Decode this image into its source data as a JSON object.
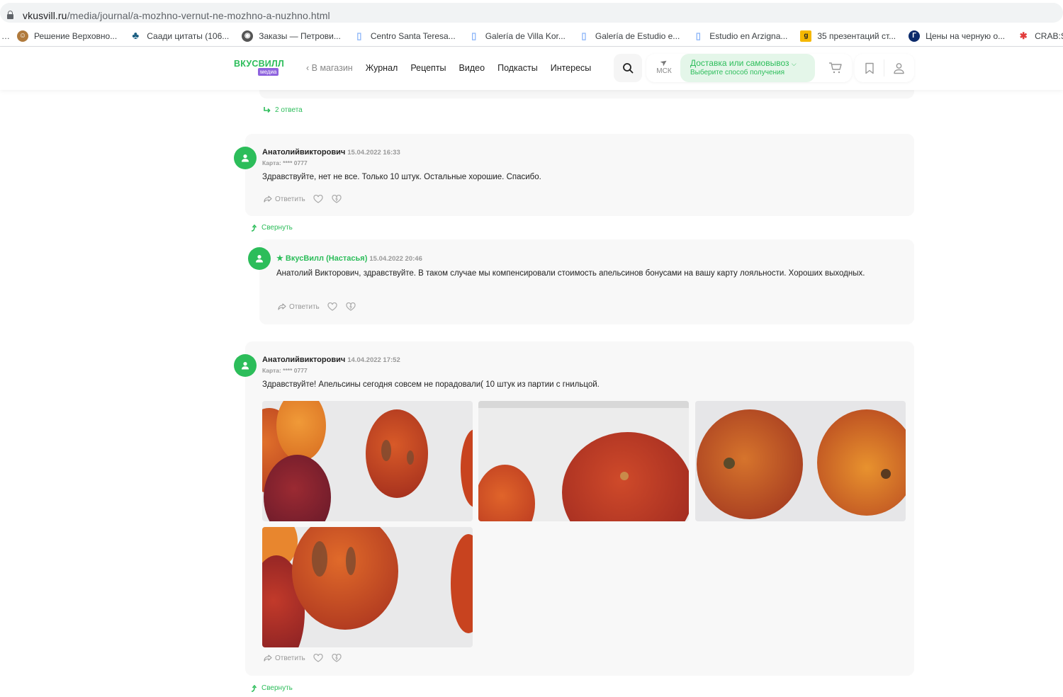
{
  "browser": {
    "url_host": "vkusvill.ru",
    "url_path": "/media/journal/a-mozhno-vernut-ne-mozhno-a-nuzhno.html",
    "bookmarks": [
      {
        "label": "Решение Верховно...",
        "icon": "portrait-icon",
        "color": "#b07a3c"
      },
      {
        "label": "Саади цитаты (106...",
        "icon": "tree-icon",
        "color": "#1c5f82"
      },
      {
        "label": "Заказы — Петрови...",
        "icon": "globe-icon",
        "color": "#555555"
      },
      {
        "label": "Centro Santa Teresa...",
        "icon": "document-icon",
        "color": "#8ab4f8"
      },
      {
        "label": "Galería de Villa Kor...",
        "icon": "document-icon",
        "color": "#8ab4f8"
      },
      {
        "label": "Galería de Estudio e...",
        "icon": "document-icon",
        "color": "#8ab4f8"
      },
      {
        "label": "Estudio en Arzigna...",
        "icon": "document-icon",
        "color": "#8ab4f8"
      },
      {
        "label": "35 презентаций ст...",
        "icon": "g-logo-icon",
        "color": "#f5b800"
      },
      {
        "label": "Цены на черную о...",
        "icon": "t-logo-icon",
        "color": "#0b2a6b"
      },
      {
        "label": "CRAB:STORE - м",
        "icon": "crab-icon",
        "color": "#e23b3b"
      }
    ]
  },
  "header": {
    "logo_top": "ВКУСВИЛЛ",
    "logo_bottom": "медиа",
    "back_label": "В магазин",
    "nav": [
      "Журнал",
      "Рецепты",
      "Видео",
      "Подкасты",
      "Интересы"
    ],
    "city": "МСК",
    "delivery_title": "Доставка или самовывоз",
    "delivery_subtitle": "Выберите способ получения"
  },
  "colors": {
    "brand_green": "#2cbd5a",
    "media_purple": "#8e63de",
    "card_bg": "#f8f8f8"
  },
  "thread": {
    "replies_link": "2 ответа",
    "comments": [
      {
        "author": "Анатолийвикторович",
        "date": "15.04.2022 16:33",
        "card": "Карта: **** 0777",
        "text": "Здравствуйте, нет не все. Только 10 штук. Остальные хорошие. Спасибо.",
        "reply_label": "Ответить"
      },
      {
        "author": "★ ВкусВилл (Настасья)",
        "date": "15.04.2022 20:46",
        "text": "Анатолий Викторович, здравствуйте. В таком случае мы компенсировали стоимость апельсинов бонусами на вашу карту лояльности. Хороших выходных.",
        "reply_label": "Ответить"
      },
      {
        "author": "Анатолийвикторович",
        "date": "14.04.2022 17:52",
        "card": "Карта: **** 0777",
        "text": "Здравствуйте! Апельсины сегодня совсем не порадовали( 10 штук из партии с гнильцой.",
        "photos": [
          "photo-oranges-1",
          "photo-oranges-2",
          "photo-oranges-3",
          "photo-oranges-4"
        ],
        "reply_label": "Ответить"
      }
    ],
    "collapse_label": "Свернуть"
  }
}
